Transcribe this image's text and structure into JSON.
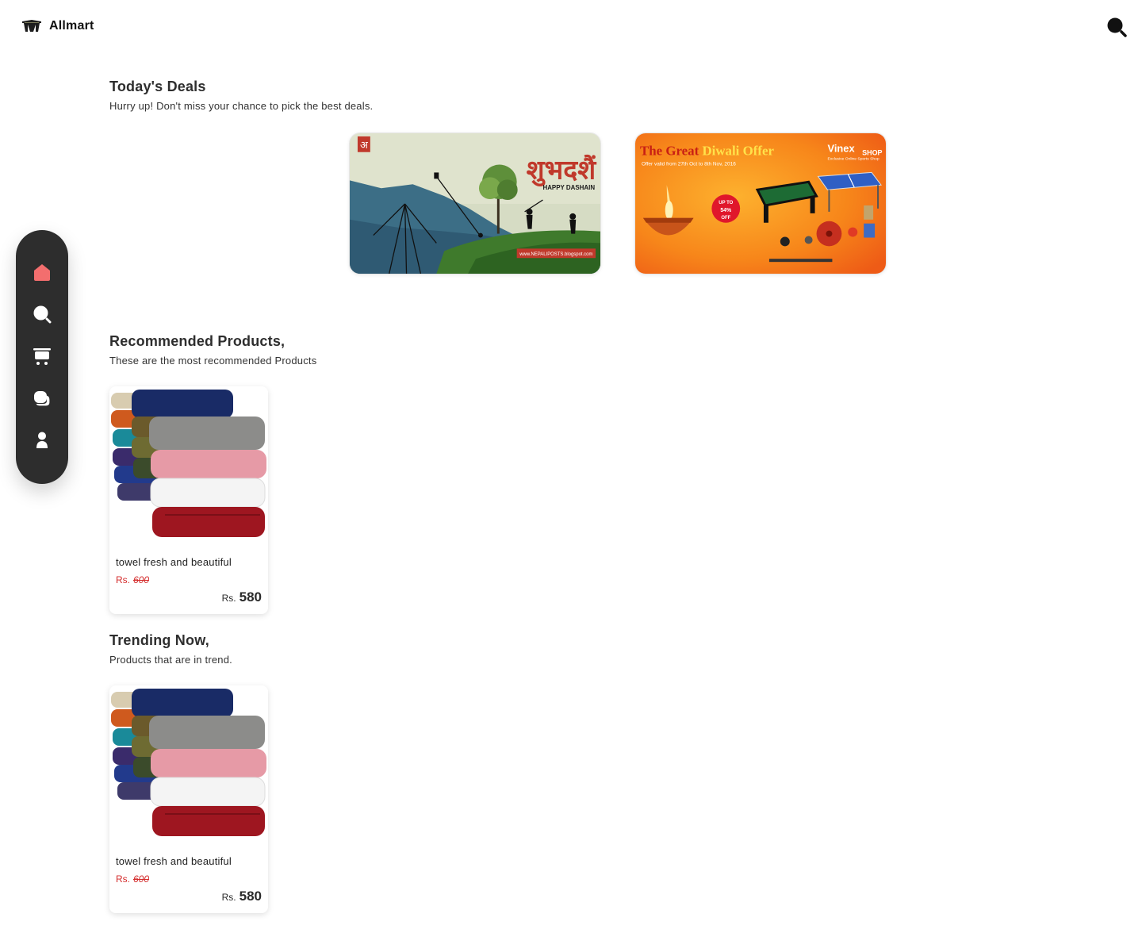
{
  "header": {
    "brand": "Allmart",
    "search_icon": "search-icon"
  },
  "sidebar": {
    "items": [
      {
        "icon": "home-icon",
        "active": true
      },
      {
        "icon": "search-icon",
        "active": false
      },
      {
        "icon": "cart-icon",
        "active": false
      },
      {
        "icon": "chat-icon",
        "active": false
      },
      {
        "icon": "user-icon",
        "active": false
      }
    ],
    "active_color": "#f36e6e"
  },
  "deals": {
    "title": "Today's Deals",
    "subtitle": "Hurry up! Don't miss your chance to pick the best deals.",
    "banners": [
      {
        "logo_text": "अ",
        "headline": "शुभदशैं",
        "tagline": "HAPPY DASHAIN",
        "site": "www.NEPALIPOSTS.blogspot.com"
      },
      {
        "headline_part1": "The Great",
        "headline_part2": "Diwali Offer",
        "offer_line": "Offer valid from 27th Oct to 8th Nov, 2016",
        "badge": [
          "UP TO",
          "54%",
          "OFF"
        ],
        "brand": "Vinex",
        "brand_sub": "SHOP",
        "brand_tagline": "Exclusive Online Sports Shop"
      }
    ]
  },
  "recommended": {
    "title": "Recommended Products,",
    "subtitle": "These are the most recommended Products",
    "products": [
      {
        "name": "towel fresh and beautiful",
        "currency": "Rs.",
        "old_price": "600",
        "price": "580"
      }
    ]
  },
  "trending": {
    "title": "Trending Now,",
    "subtitle": "Products that are in trend.",
    "products": [
      {
        "name": "towel fresh and beautiful",
        "currency": "Rs.",
        "old_price": "600",
        "price": "580"
      }
    ]
  }
}
